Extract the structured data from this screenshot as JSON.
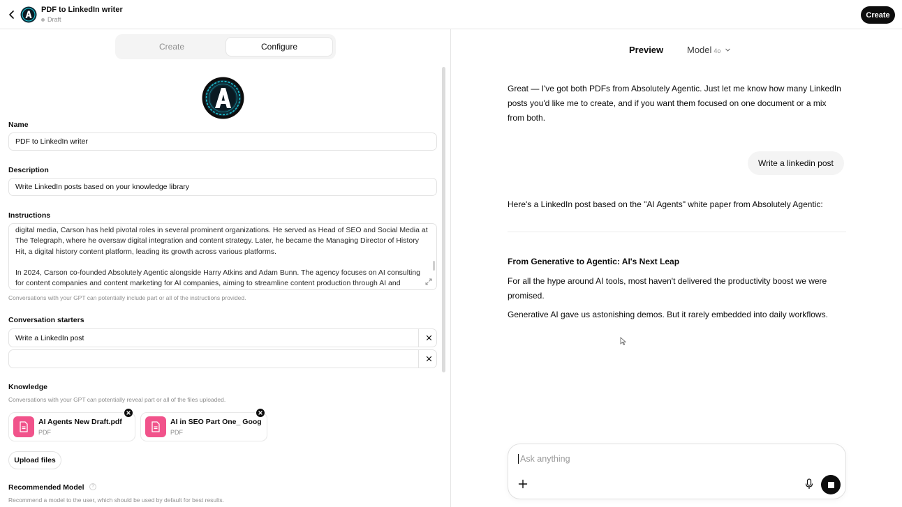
{
  "header": {
    "title": "PDF to LinkedIn writer",
    "status": "Draft",
    "create_label": "Create"
  },
  "tabs": [
    {
      "label": "Create",
      "active": false
    },
    {
      "label": "Configure",
      "active": true
    }
  ],
  "form": {
    "name_label": "Name",
    "name_value": "PDF to LinkedIn writer",
    "description_label": "Description",
    "description_value": "Write LinkedIn posts based on your knowledge library",
    "instructions_label": "Instructions",
    "instructions_paragraphs": [
      "digital media, Carson has held pivotal roles in several prominent organizations. He served as Head of SEO and Social Media at The Telegraph, where he oversaw digital integration and content strategy. Later, he became the Managing Director of History Hit, a digital history content platform, leading its growth across various platforms.",
      "In 2024, Carson co-founded Absolutely Agentic alongside Harry Atkins and Adam Bunn. The agency focuses on AI consulting for content companies and content marketing for AI companies, aiming to streamline content production through AI and"
    ],
    "instructions_hint": "Conversations with your GPT can potentially include part or all of the instructions provided.",
    "starters_label": "Conversation starters",
    "starters": [
      "Write a LinkedIn post",
      ""
    ],
    "knowledge_label": "Knowledge",
    "knowledge_hint": "Conversations with your GPT can potentially reveal part or all of the files uploaded.",
    "files": [
      {
        "name": "AI Agents New Draft.pdf",
        "type": "PDF"
      },
      {
        "name": "AI in SEO Part One_ Goog",
        "type": "PDF"
      }
    ],
    "upload_label": "Upload files",
    "recommended_model_label": "Recommended Model",
    "recommended_model_hint": "Recommend a model to the user, which should be used by default for best results.",
    "help_icon": "?"
  },
  "preview": {
    "title": "Preview",
    "model_label": "Model",
    "model_version": "4o",
    "messages": {
      "assistant_1": "Great — I've got both PDFs from Absolutely Agentic. Just let me know how many LinkedIn posts you'd like me to create, and if you want them focused on one document or a mix from both.",
      "user_1": "Write a linkedin post",
      "assistant_2": "Here's a LinkedIn post based on the \"AI Agents\" white paper from Absolutely Agentic:",
      "post_heading": "From Generative to Agentic: AI's Next Leap",
      "post_p1": "For all the hype around AI tools, most haven't delivered the productivity boost we were promised.",
      "post_p2": "Generative AI gave us astonishing demos. But it rarely embedded into daily workflows."
    },
    "composer_placeholder": "Ask anything"
  },
  "colors": {
    "file_icon_bg": "#f1538b",
    "primary": "#0d0d0d",
    "logo_ring": "#1ec8d8"
  }
}
